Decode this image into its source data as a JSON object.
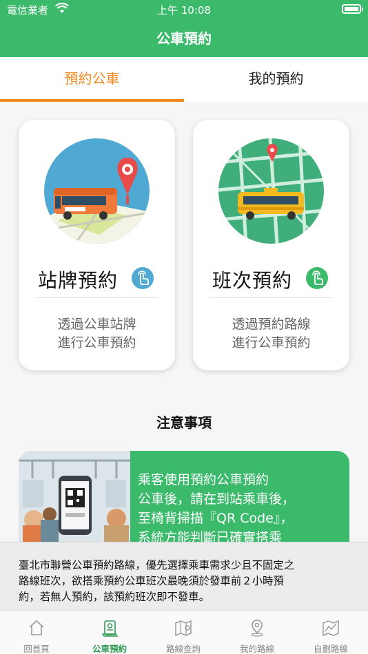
{
  "status_bar": {
    "carrier": "電信業者",
    "time": "上午 10:08"
  },
  "header": {
    "title": "公車預約"
  },
  "tabs": [
    {
      "label": "預約公車",
      "active": true
    },
    {
      "label": "我的預約",
      "active": false
    }
  ],
  "cards": [
    {
      "title": "站牌預約",
      "desc_line1": "透過公車站牌",
      "desc_line2": "進行公車預約"
    },
    {
      "title": "班次預約",
      "desc_line1": "透過預約路線",
      "desc_line2": "進行公車預約"
    }
  ],
  "notes": {
    "title": "注意事項",
    "lines": [
      "乘客使用預約公車預約",
      "公車後，請在到站乘車後，",
      "至椅背掃描『QR Code』，",
      "系統方能判斷已確實搭乘"
    ]
  },
  "banner": {
    "lines": [
      "臺北市聯營公車預約路線，優先選擇乘車需求少且不固定之",
      "路線班次，欲搭乘預約公車班次最晚須於發車前２小時預",
      "約，若無人預約，該預約班次即不發車。"
    ]
  },
  "tabbar": [
    {
      "label": "回首頁",
      "icon": "home-icon"
    },
    {
      "label": "公車預約",
      "icon": "booking-icon",
      "active": true
    },
    {
      "label": "路線查詢",
      "icon": "route-map-icon"
    },
    {
      "label": "我的路線",
      "icon": "location-pin-icon"
    },
    {
      "label": "自劃路線",
      "icon": "custom-route-icon"
    }
  ],
  "colors": {
    "primary_green": "#3cba6b",
    "accent_orange": "#f08a24",
    "tap_blue": "#4fa9d3",
    "tap_green": "#3cba6b"
  }
}
